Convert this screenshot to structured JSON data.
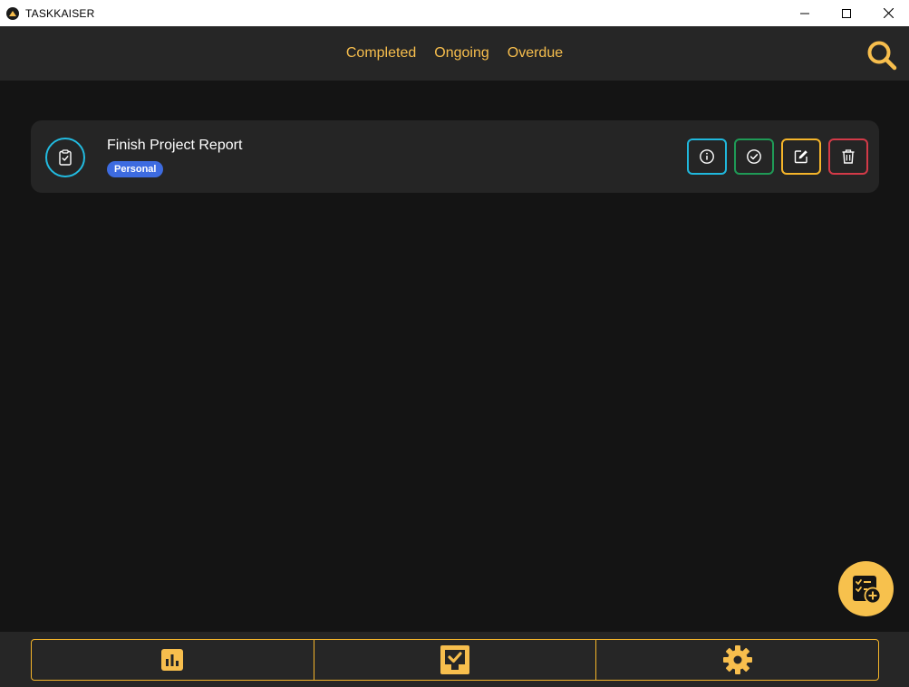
{
  "window": {
    "title": "TASKKAISER",
    "controls": [
      "minimize",
      "maximize",
      "close"
    ]
  },
  "header": {
    "tabs": [
      {
        "label": "Completed"
      },
      {
        "label": "Ongoing"
      },
      {
        "label": "Overdue"
      }
    ],
    "search_icon": "search-icon"
  },
  "tasks": [
    {
      "title": "Finish Project Report",
      "tag": "Personal",
      "icon": "clipboard-check-icon",
      "actions": [
        "info-icon",
        "check-circle-icon",
        "edit-icon",
        "trash-icon"
      ]
    }
  ],
  "fab": {
    "icon": "add-task-icon"
  },
  "bottom_nav": {
    "items": [
      {
        "icon": "bar-chart-icon"
      },
      {
        "icon": "tasks-icon"
      },
      {
        "icon": "gear-icon"
      }
    ]
  },
  "colors": {
    "accent": "#f7be4d",
    "background": "#141414",
    "surface": "#252525",
    "header": "#262626",
    "info": "#20b8dd",
    "success": "#1f9a56",
    "warning": "#f5b52a",
    "danger": "#d33a48",
    "tag_personal": "#3d6be0"
  }
}
